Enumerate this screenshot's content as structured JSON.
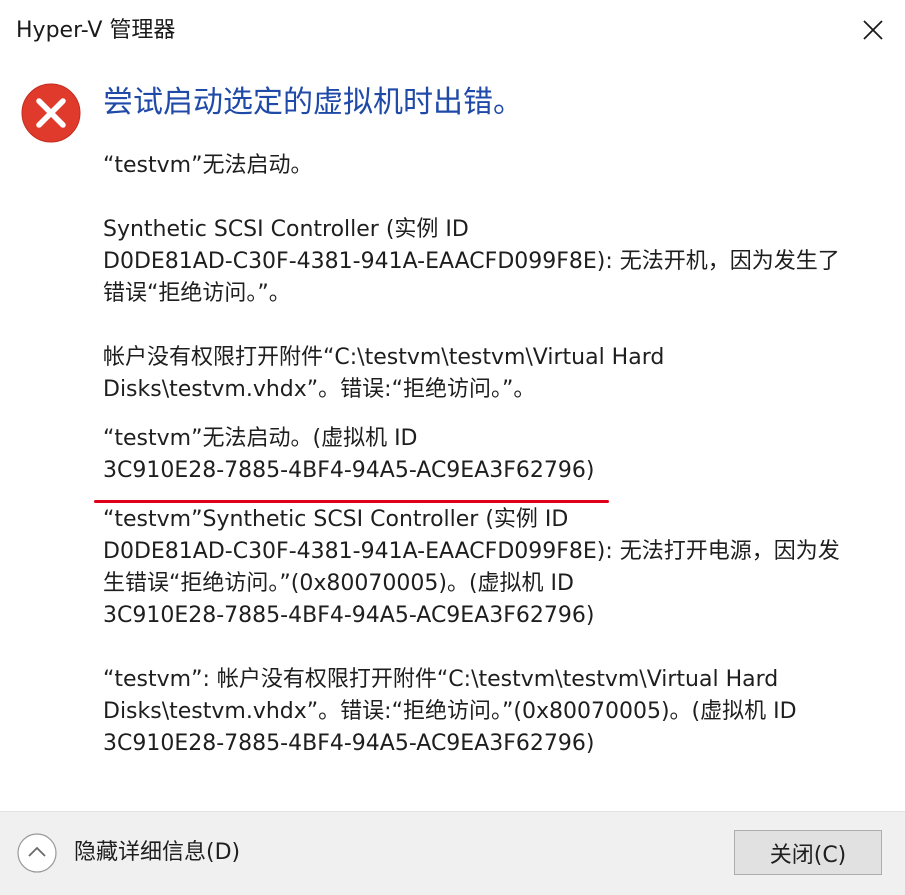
{
  "window": {
    "title": "Hyper-V 管理器"
  },
  "dialog": {
    "main_instruction": "尝试启动选定的虚拟机时出错。",
    "paragraphs": [
      "“testvm”无法启动。",
      "Synthetic SCSI Controller (实例 ID\nD0DE81AD-C30F-4381-941A-EAACFD099F8E): 无法开机，因为发生了\n错误“拒绝访问。”。",
      " 帐户没有权限打开附件“C:\\testvm\\testvm\\Virtual Hard\nDisks\\testvm.vhdx”。错误:“拒绝访问。”。",
      "“testvm”无法启动。(虚拟机 ID\n3C910E28-7885-4BF4-94A5-AC9EA3F62796)",
      "“testvm”Synthetic SCSI Controller (实例 ID\nD0DE81AD-C30F-4381-941A-EAACFD099F8E): 无法打开电源，因为发\n生错误“拒绝访问。”(0x80070005)。(虚拟机 ID\n3C910E28-7885-4BF4-94A5-AC9EA3F62796)",
      "“testvm”: 帐户没有权限打开附件“C:\\testvm\\testvm\\Virtual Hard\nDisks\\testvm.vhdx”。错误:“拒绝访问。”(0x80070005)。(虚拟机 ID\n3C910E28-7885-4BF4-94A5-AC9EA3F62796)"
    ]
  },
  "footer": {
    "details_toggle_label": "隐藏详细信息(D)",
    "close_button_label": "关闭(C)"
  },
  "colors": {
    "instruction_text": "#1f4aa8",
    "error_icon": "#e03a2d",
    "annotation_underline": "#e0001a",
    "footer_background": "#f0f0f0"
  },
  "icons": {
    "error": "error-x-circle-icon",
    "close": "close-icon",
    "collapse": "chevron-up-icon"
  }
}
